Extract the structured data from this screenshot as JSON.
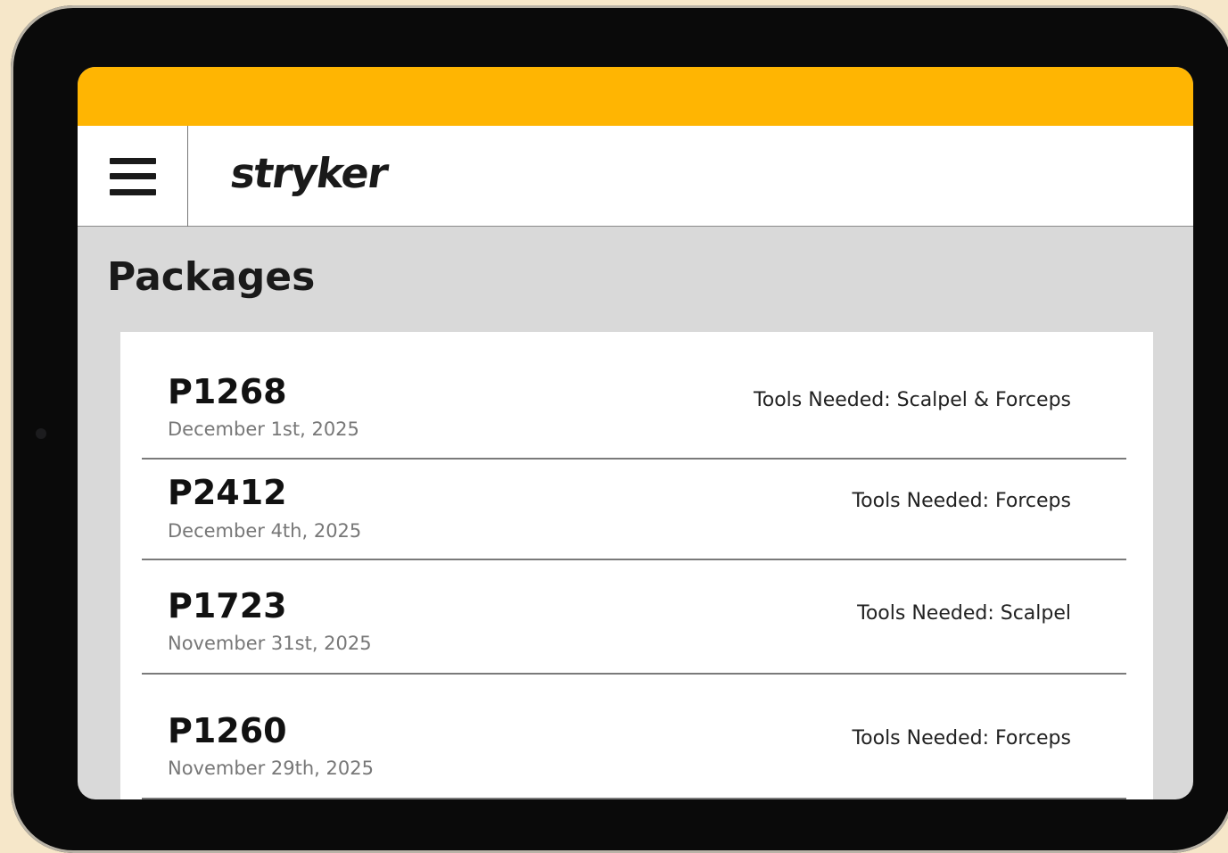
{
  "header": {
    "logo_text": "stryker",
    "menu_icon": "hamburger-menu-icon"
  },
  "page": {
    "title": "Packages"
  },
  "packages": [
    {
      "id": "P1268",
      "date": "December 1st, 2025",
      "tools": "Tools Needed: Scalpel & Forceps"
    },
    {
      "id": "P2412",
      "date": "December 4th, 2025",
      "tools": "Tools Needed: Forceps"
    },
    {
      "id": "P1723",
      "date": "November 31st, 2025",
      "tools": "Tools Needed: Scalpel"
    },
    {
      "id": "P1260",
      "date": "November 29th, 2025",
      "tools": "Tools Needed: Forceps"
    }
  ],
  "colors": {
    "accent": "#ffb502",
    "background": "#d9d9d9",
    "card": "#ffffff",
    "device_frame": "#0a0a0a"
  }
}
